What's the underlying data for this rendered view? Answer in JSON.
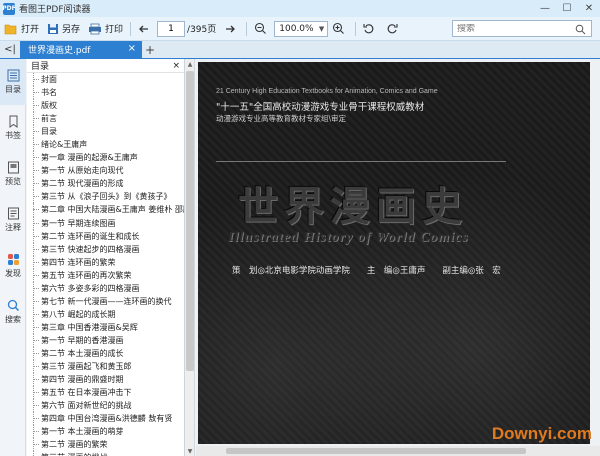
{
  "window": {
    "title": "看图王PDF阅读器",
    "logo": "PDF",
    "min": "—",
    "max": "☐",
    "close": "✕"
  },
  "toolbar": {
    "open_label": "打开",
    "save_as_label": "另存",
    "print_label": "打印",
    "page_current": "1",
    "page_total": "/395页",
    "zoom_value": "100.0%",
    "search_placeholder": "搜索"
  },
  "tabs": {
    "collapse": "<|",
    "active_tab": "世界漫画史.pdf",
    "close": "×",
    "new_tab": "+"
  },
  "rail": [
    {
      "label": "目录",
      "icon": "list-icon"
    },
    {
      "label": "书签",
      "icon": "bookmark-icon"
    },
    {
      "label": "预览",
      "icon": "preview-icon"
    },
    {
      "label": "注释",
      "icon": "annotation-icon"
    },
    {
      "label": "发现",
      "icon": "discover-icon"
    },
    {
      "label": "搜索",
      "icon": "search-icon"
    }
  ],
  "outline": {
    "header": "目录",
    "items": [
      "封面",
      "书名",
      "版权",
      "前言",
      "目录",
      "绪论&王庸声",
      "第一章 漫画的起源&王庸声",
      "第一节 从原始走向现代",
      "第二节 现代漫画的形成",
      "第三节 从《浪子回头》到《黄孩子》",
      "第二章 中国大陆漫画&王庸声 姜维朴 邵胜",
      "第一节 早期连续图画",
      "第二节 连环画的诞生和成长",
      "第三节 快速起步的四格漫画",
      "第四节 连环画的繁荣",
      "第五节 连环画的再次繁荣",
      "第六节 多姿多彩的四格漫画",
      "第七节 新一代漫画——连环画的换代",
      "第八节 崛起的成长期",
      "第三章 中国香港漫画&吴辉",
      "第一节 早期的香港漫画",
      "第二节 本土漫画的成长",
      "第三节 漫画起飞和黄玉郎",
      "第四节 漫画的鼎盛时期",
      "第五节 在日本漫画冲击下",
      "第六节 面对新世纪的挑战",
      "第四章 中国台湾漫画&洪德麟 敖有贤",
      "第一节 本土漫画的萌芽",
      "第二节 漫画的繁荣",
      "第三节 漫画的挑战"
    ]
  },
  "cover": {
    "en_series": "21 Century High Education Textbooks for Animation, Comics and Game",
    "cn_series": "\"十一五\"全国高校动漫游戏专业骨干课程权威教材",
    "committee": "动漫游戏专业高等教育教材专家组\\审定",
    "title": "世界漫画史",
    "subtitle": "Illustrated History of World Comics",
    "credits": "策　划◎北京电影学院动画学院　　主　编◎王庸声　　副主编◎张　宏"
  },
  "watermark": "Downyi.com"
}
